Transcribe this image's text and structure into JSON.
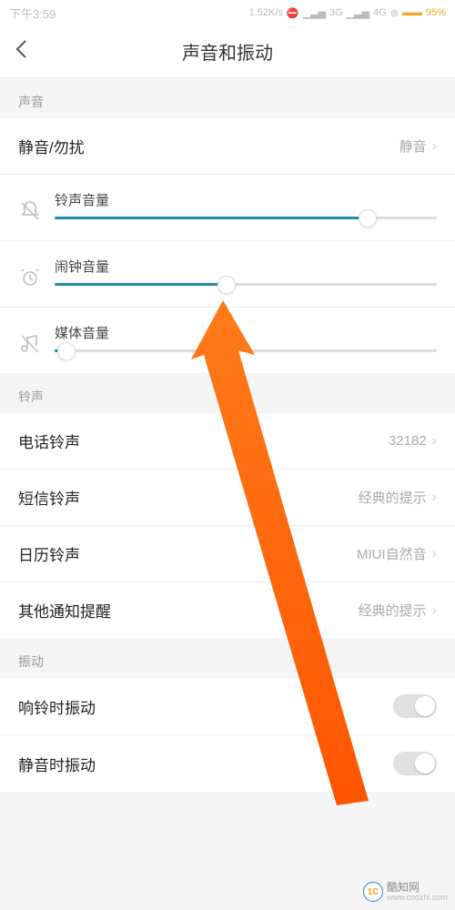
{
  "status_bar": {
    "time": "下午3:59",
    "speed": "1.52K/s",
    "signal1": "3G",
    "signal2": "4G",
    "battery_pct": "95%"
  },
  "header": {
    "title": "声音和振动"
  },
  "sections": {
    "sound": {
      "label": "声音",
      "silent_row": {
        "label": "静音/勿扰",
        "value": "静音"
      },
      "sliders": {
        "ringtone": {
          "label": "铃声音量",
          "percent": 82
        },
        "alarm": {
          "label": "闹钟音量",
          "percent": 45
        },
        "media": {
          "label": "媒体音量",
          "percent": 3
        }
      }
    },
    "ringtone": {
      "label": "铃声",
      "items": [
        {
          "label": "电话铃声",
          "value": "32182"
        },
        {
          "label": "短信铃声",
          "value": "经典的提示"
        },
        {
          "label": "日历铃声",
          "value": "MIUI自然音"
        },
        {
          "label": "其他通知提醒",
          "value": "经典的提示"
        }
      ]
    },
    "vibration": {
      "label": "振动",
      "items": [
        {
          "label": "响铃时振动"
        },
        {
          "label": "静音时振动"
        }
      ]
    }
  },
  "watermark": {
    "name": "酷知网",
    "url": "www.coozhi.com",
    "logo": "1C"
  }
}
